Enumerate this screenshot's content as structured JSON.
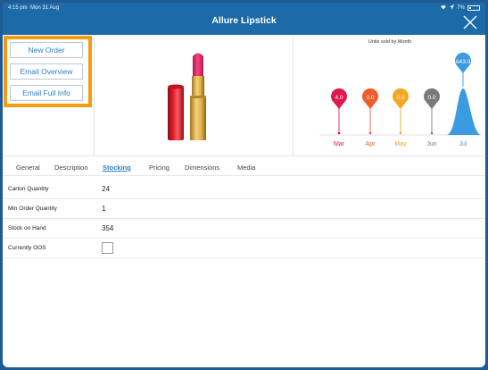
{
  "status_bar": {
    "time": "4:15 pm",
    "date": "Mon 31 Aug",
    "battery": "7%"
  },
  "header": {
    "title": "Allure Lipstick"
  },
  "actions": {
    "new_order": "New Order",
    "email_overview": "Email Overview",
    "email_full_info": "Email Full Info"
  },
  "colors": {
    "accent": "#f39c12",
    "header": "#1d6aa8",
    "link": "#2d7fc0"
  },
  "tabs": [
    {
      "label": "General"
    },
    {
      "label": "Description"
    },
    {
      "label": "Stocking",
      "active": true
    },
    {
      "label": "Pricing"
    },
    {
      "label": "Dimensions"
    },
    {
      "label": "Media"
    }
  ],
  "stocking": {
    "carton_quantity": {
      "label": "Carton Quantity",
      "value": "24"
    },
    "min_order_quantity": {
      "label": "Min Order Quantity",
      "value": "1"
    },
    "stock_on_hand": {
      "label": "Stock on Hand",
      "value": "354"
    },
    "currently_oos": {
      "label": "Currently OOS",
      "checked": false
    }
  },
  "chart_data": {
    "type": "line",
    "title": "Units sold by Month",
    "categories": [
      "Mar",
      "Apr",
      "May",
      "Jun",
      "Jul"
    ],
    "values": [
      4.0,
      0.0,
      0.0,
      0.0,
      643.0
    ],
    "labels": [
      "4.0",
      "0.0",
      "0.0",
      "0.0",
      "643.0"
    ],
    "colors": [
      "#e0194d",
      "#f15a2b",
      "#f5a623",
      "#7a7a7a",
      "#3a9be0"
    ],
    "xlabel": "",
    "ylabel": ""
  }
}
